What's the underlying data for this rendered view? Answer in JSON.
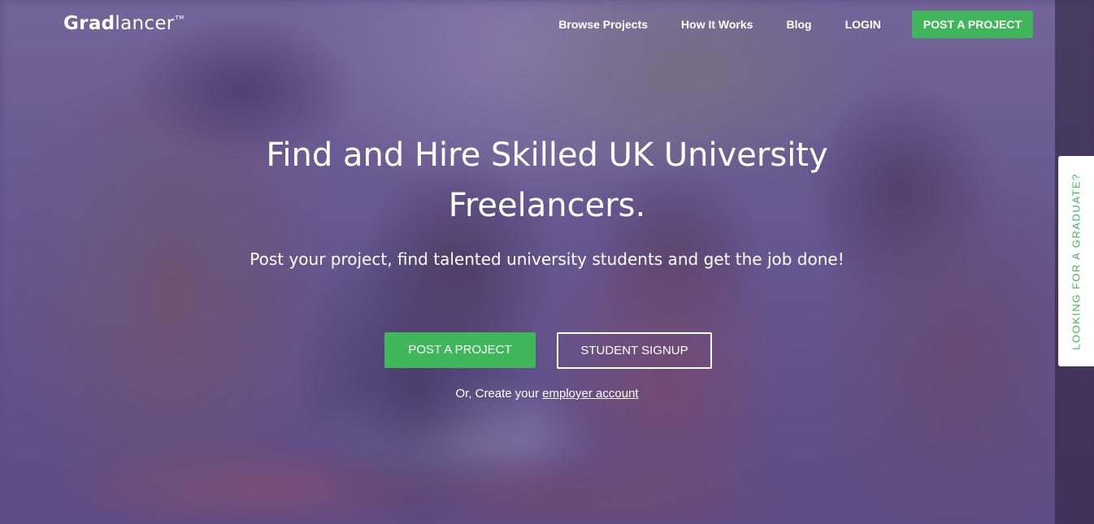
{
  "header": {
    "logo_bold": "Grad",
    "logo_light": "lancer",
    "logo_tm": "TM",
    "nav": [
      {
        "label": "Browse Projects"
      },
      {
        "label": "How It Works"
      },
      {
        "label": "Blog"
      },
      {
        "label": "LOGIN"
      }
    ],
    "cta_label": "POST A PROJECT"
  },
  "hero": {
    "headline_line1": "Find and Hire Skilled UK University",
    "headline_line2": "Freelancers.",
    "subhead": "Post your project, find talented university students and get the job done!",
    "primary_button": "POST A PROJECT",
    "secondary_button": "STUDENT SIGNUP",
    "or_prefix": "Or, Create your",
    "or_link": "employer account"
  },
  "side_tab": {
    "label": "LOOKING FOR A GRADUATE?"
  },
  "colors": {
    "accent_green": "#3fb65a",
    "overlay_purple": "#604c8c",
    "text_white": "#ffffff"
  }
}
